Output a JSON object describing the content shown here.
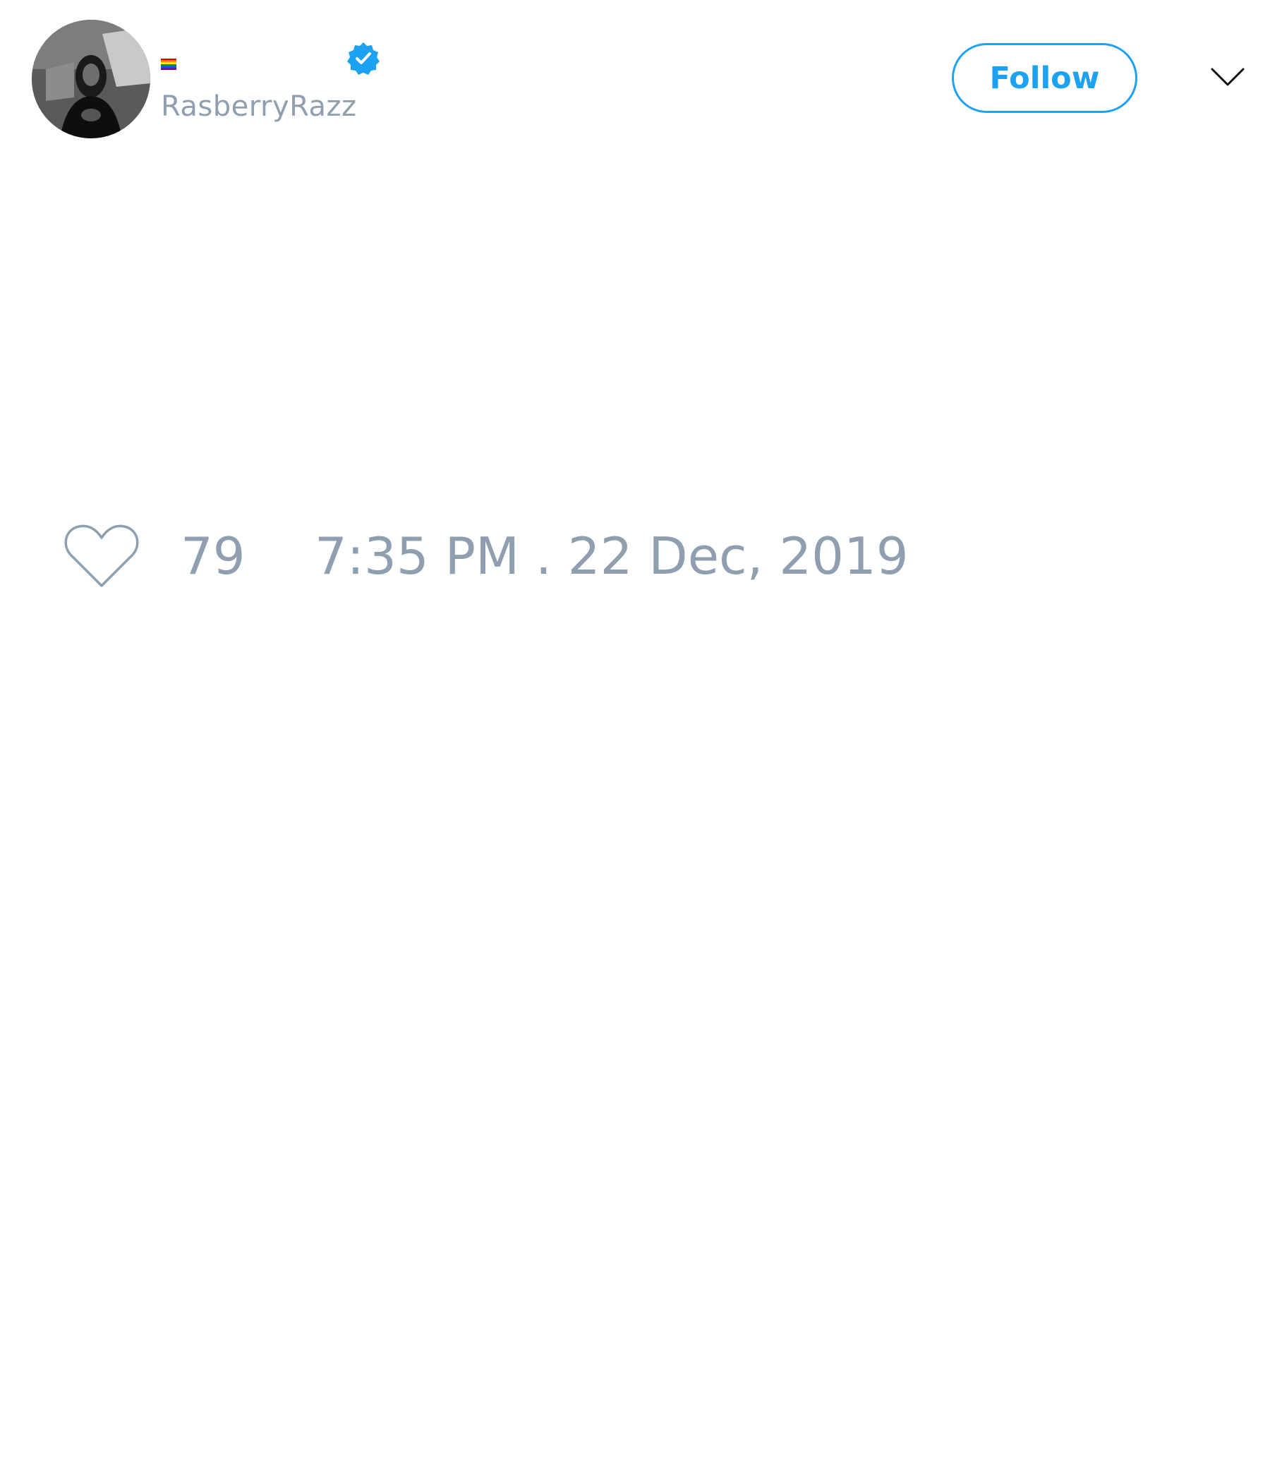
{
  "user": {
    "display_name": "",
    "handle": "RasberryRazz",
    "flag_icon": "rainbow-flag-icon",
    "verified_icon": "verified-badge-icon",
    "verified_color": "#1da1f2"
  },
  "actions": {
    "follow_label": "Follow",
    "follow_color": "#1da1f2",
    "menu_icon": "chevron-down-icon"
  },
  "footer": {
    "like_icon": "heart-icon",
    "like_count": "79",
    "timestamp": "7:35 PM . 22 Dec, 2019",
    "text_color": "#8f9fb0"
  }
}
